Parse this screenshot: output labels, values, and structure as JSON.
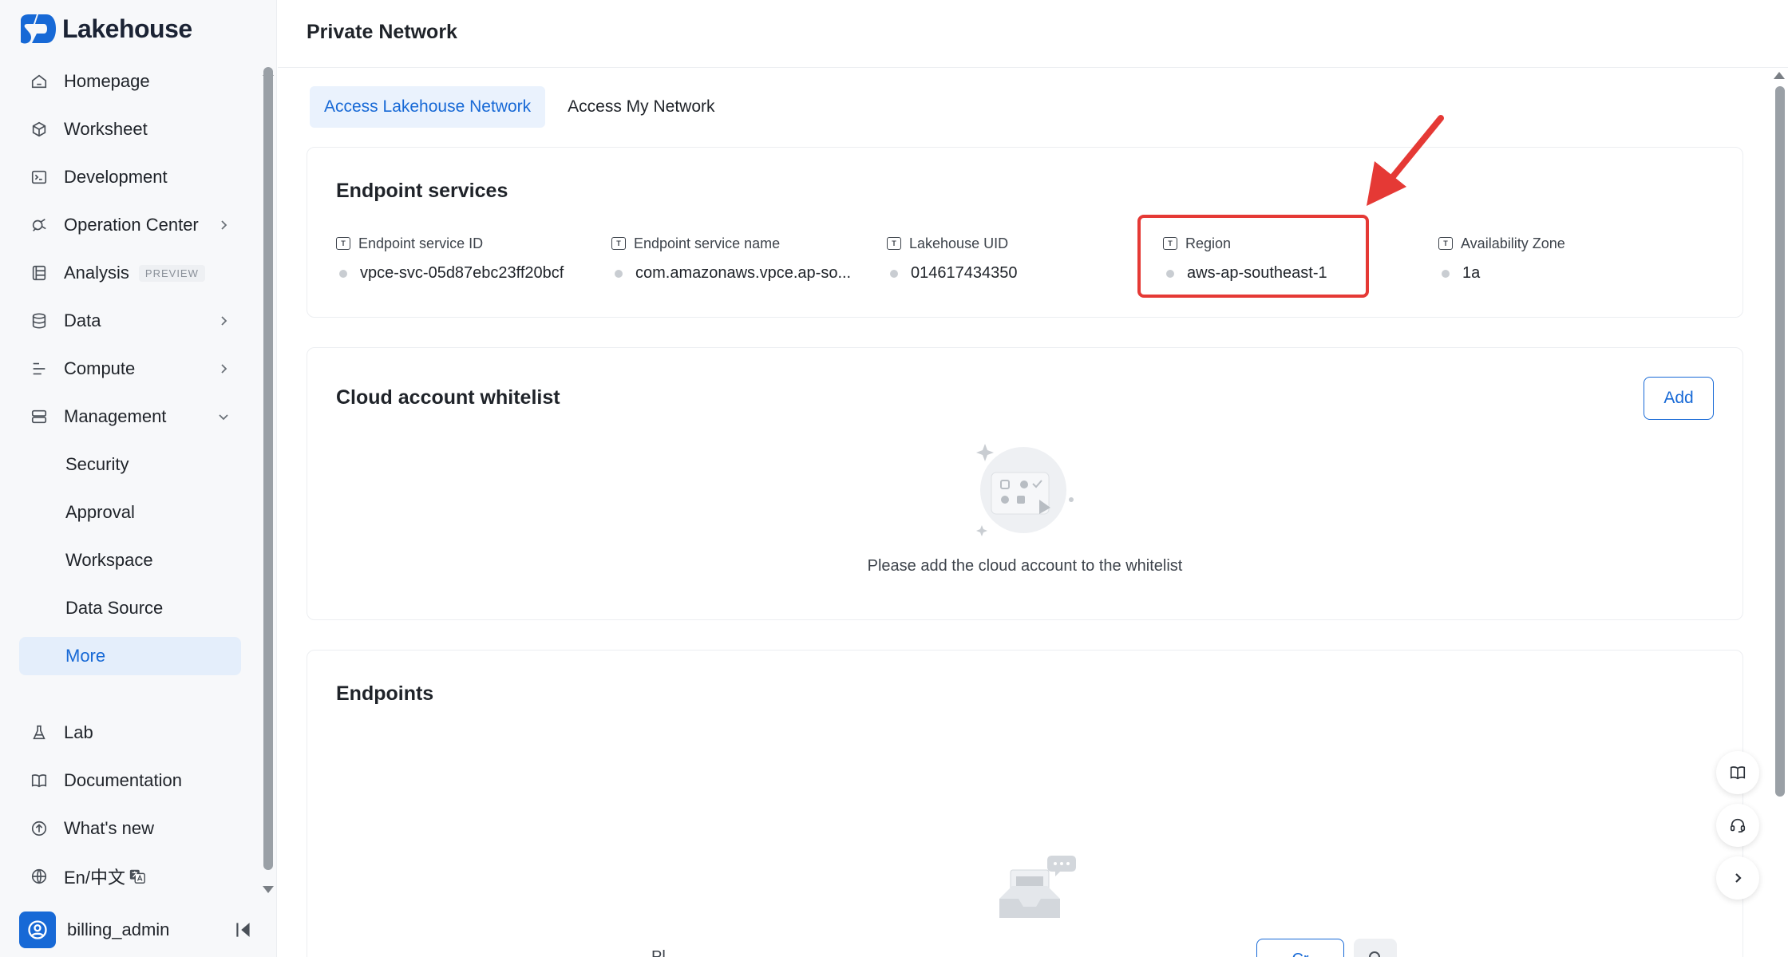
{
  "app": {
    "name": "Lakehouse"
  },
  "sidebar": {
    "items": [
      {
        "label": "Homepage",
        "icon": "home-icon"
      },
      {
        "label": "Worksheet",
        "icon": "cube-icon"
      },
      {
        "label": "Development",
        "icon": "terminal-icon"
      },
      {
        "label": "Operation Center",
        "icon": "operation-icon",
        "has_children": true
      },
      {
        "label": "Analysis",
        "icon": "analysis-icon",
        "badge": "PREVIEW"
      },
      {
        "label": "Data",
        "icon": "database-icon",
        "has_children": true
      },
      {
        "label": "Compute",
        "icon": "compute-icon",
        "has_children": true
      },
      {
        "label": "Management",
        "icon": "server-icon",
        "expanded": true
      }
    ],
    "management_children": [
      "Security",
      "Approval",
      "Workspace",
      "Data Source",
      "More"
    ],
    "active_child": "More",
    "bottom_items": [
      {
        "label": "Lab",
        "icon": "flask-icon"
      },
      {
        "label": "Documentation",
        "icon": "book-icon"
      },
      {
        "label": "What's new",
        "icon": "arrow-up-circle-icon"
      },
      {
        "label": "En/中文",
        "icon": "globe-icon"
      }
    ],
    "user": {
      "name": "billing_admin"
    }
  },
  "page": {
    "title": "Private Network"
  },
  "tabs": [
    {
      "label": "Access Lakehouse Network",
      "active": true
    },
    {
      "label": "Access My Network",
      "active": false
    }
  ],
  "endpoint_services": {
    "title": "Endpoint services",
    "fields": [
      {
        "label": "Endpoint service ID",
        "value": "vpce-svc-05d87ebc23ff20bcf"
      },
      {
        "label": "Endpoint service name",
        "value": "com.amazonaws.vpce.ap-so..."
      },
      {
        "label": "Lakehouse UID",
        "value": "014617434350"
      },
      {
        "label": "Region",
        "value": "aws-ap-southeast-1"
      },
      {
        "label": "Availability Zone",
        "value": "1a"
      }
    ],
    "highlighted_field": "Region"
  },
  "whitelist": {
    "title": "Cloud account whitelist",
    "add_label": "Add",
    "empty_text": "Please add the cloud account to the whitelist"
  },
  "endpoints": {
    "title": "Endpoints",
    "partial_text": "Pl",
    "partial_button": "Cr"
  },
  "colors": {
    "accent": "#1769d6",
    "highlight": "#e53935",
    "active_bg": "#e4eefb"
  }
}
